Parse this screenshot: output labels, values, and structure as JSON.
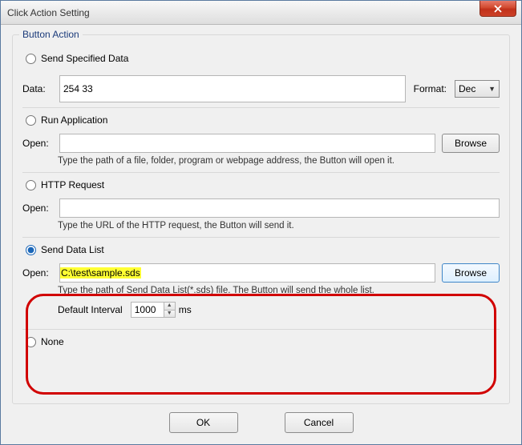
{
  "window": {
    "title": "Click Action Setting"
  },
  "group": {
    "title": "Button Action"
  },
  "actions": {
    "send_specified": {
      "label": "Send Specified Data",
      "selected": false
    },
    "run_app": {
      "label": "Run Application",
      "selected": false
    },
    "http": {
      "label": "HTTP Request",
      "selected": false
    },
    "send_list": {
      "label": "Send Data List",
      "selected": true
    },
    "none": {
      "label": "None",
      "selected": false
    }
  },
  "data_field": {
    "label": "Data:",
    "value": "254 33"
  },
  "format": {
    "label": "Format:",
    "selected": "Dec"
  },
  "run_open": {
    "label": "Open:",
    "value": "",
    "browse": "Browse",
    "hint": "Type the path of a file, folder, program or webpage address, the Button will open it."
  },
  "http_open": {
    "label": "Open:",
    "value": "",
    "hint": "Type the URL of the HTTP request, the Button will send it."
  },
  "list_open": {
    "label": "Open:",
    "value": "C:\\test\\sample.sds",
    "browse": "Browse",
    "hint": "Type the path of Send Data List(*.sds) file. The Button will send the whole list."
  },
  "interval": {
    "label": "Default Interval",
    "value": "1000",
    "unit": "ms"
  },
  "buttons": {
    "ok": "OK",
    "cancel": "Cancel"
  }
}
